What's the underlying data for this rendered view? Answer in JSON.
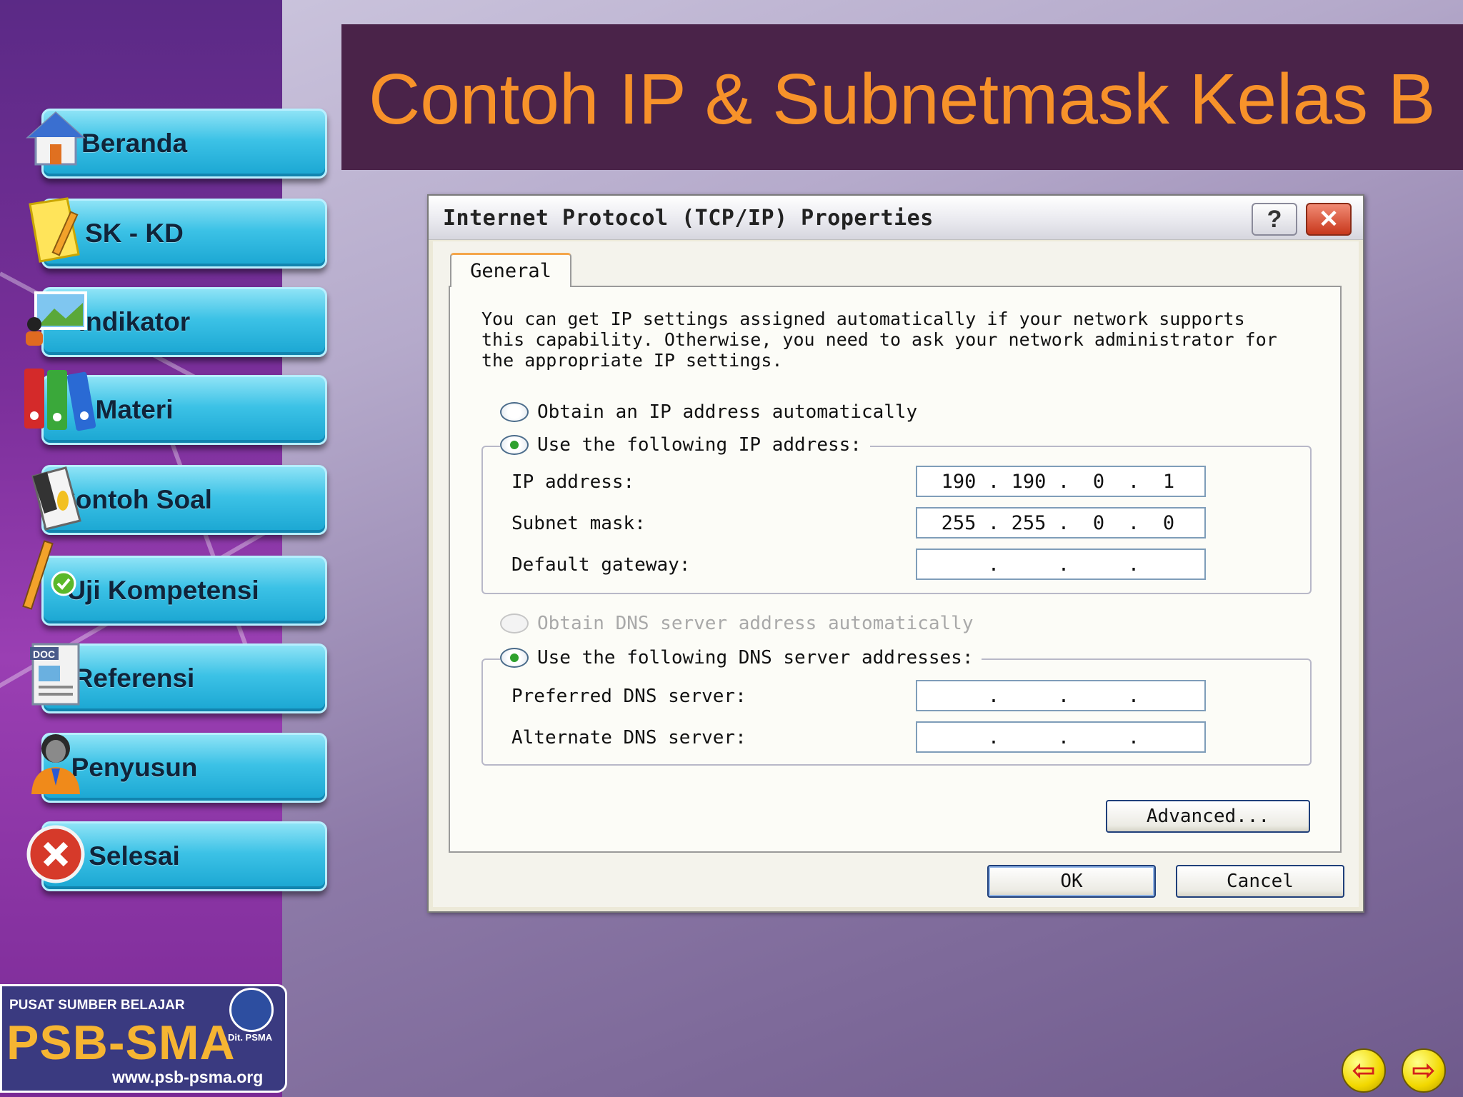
{
  "slide": {
    "title": "Contoh IP & Subnetmask Kelas B",
    "colors": {
      "title_text": "#f7922a",
      "title_band": "#4a2349",
      "nav_button": "#3cc2e6"
    }
  },
  "sidebar": {
    "items": [
      {
        "label": "Beranda",
        "icon": "house-icon"
      },
      {
        "label": "SK - KD",
        "icon": "notepad-pencil-icon"
      },
      {
        "label": "Indikator",
        "icon": "presenter-board-icon"
      },
      {
        "label": "Materi",
        "icon": "binders-icon"
      },
      {
        "label": "Contoh Soal",
        "icon": "document-pen-icon"
      },
      {
        "label": "Uji Kompetensi",
        "icon": "pencil-check-icon"
      },
      {
        "label": "Referensi",
        "icon": "doc-file-icon"
      },
      {
        "label": "Penyusun",
        "icon": "person-icon"
      },
      {
        "label": "Selesai",
        "icon": "red-x-icon"
      }
    ]
  },
  "dialog": {
    "title": "Internet Protocol (TCP/IP) Properties",
    "help_label": "?",
    "close_label": "✕",
    "tab": "General",
    "description_lines": [
      "You can get IP settings assigned automatically if your network supports",
      "this capability. Otherwise, you need to ask your network administrator for",
      "the appropriate IP settings."
    ],
    "radio_obtain_ip": "Obtain an IP address automatically",
    "radio_use_ip": "Use the following IP address:",
    "ip_label": "IP address:",
    "ip_octets": [
      "190",
      "190",
      "0",
      "1"
    ],
    "subnet_label": "Subnet mask:",
    "subnet_octets": [
      "255",
      "255",
      "0",
      "0"
    ],
    "gateway_label": "Default gateway:",
    "gateway_octets": [
      "",
      "",
      "",
      ""
    ],
    "radio_obtain_dns": "Obtain DNS server address automatically",
    "radio_use_dns": "Use the following DNS server addresses:",
    "preferred_dns_label": "Preferred DNS server:",
    "preferred_dns_octets": [
      "",
      "",
      "",
      ""
    ],
    "alternate_dns_label": "Alternate DNS server:",
    "alternate_dns_octets": [
      "",
      "",
      "",
      ""
    ],
    "advanced_label": "Advanced...",
    "ok_label": "OK",
    "cancel_label": "Cancel"
  },
  "logo": {
    "line1": "PUSAT SUMBER BELAJAR",
    "brand": "PSB-SMA",
    "unit": "Dit. PSMA",
    "url": "www.psb-psma.org"
  },
  "navigation": {
    "prev_label": "⇦",
    "next_label": "⇨"
  }
}
